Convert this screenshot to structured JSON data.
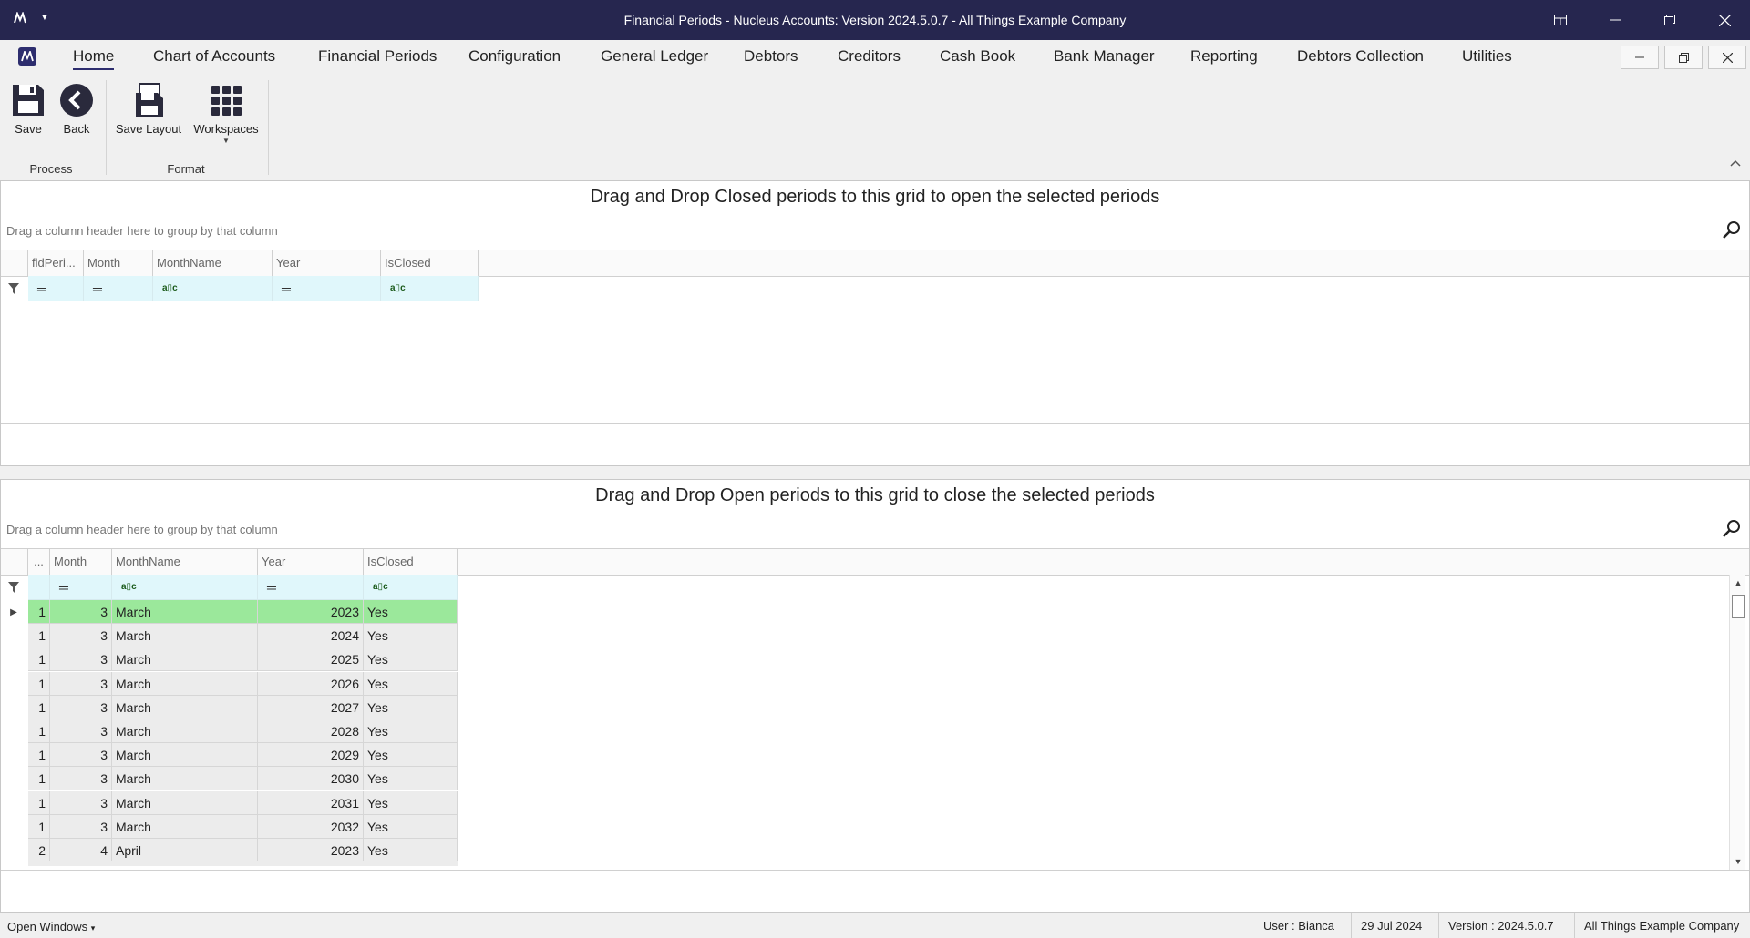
{
  "window": {
    "title": "Financial Periods - Nucleus Accounts: Version 2024.5.0.7 - All Things Example Company"
  },
  "menu": {
    "items": [
      "Home",
      "Chart of Accounts",
      "Financial Periods",
      "Configuration",
      "General Ledger",
      "Debtors",
      "Creditors",
      "Cash Book",
      "Bank Manager",
      "Reporting",
      "Debtors Collection",
      "Utilities"
    ],
    "active": "Home"
  },
  "ribbon": {
    "save": "Save",
    "back": "Back",
    "save_layout": "Save Layout",
    "workspaces": "Workspaces",
    "group_process": "Process",
    "group_format": "Format"
  },
  "closed_panel": {
    "title": "Drag and Drop Closed periods to this grid to open the selected periods",
    "group_hint": "Drag a column header here to group by that column",
    "columns": [
      "fldPeri...",
      "Month",
      "MonthName",
      "Year",
      "IsClosed"
    ]
  },
  "open_panel": {
    "title": "Drag and Drop Open periods to this grid to close the selected periods",
    "group_hint": "Drag a column header here to group by that column",
    "columns": [
      "...",
      "Month",
      "MonthName",
      "Year",
      "IsClosed"
    ],
    "rows": [
      {
        "id": "1",
        "month": "3",
        "month_name": "March",
        "year": "2023",
        "is_closed": "Yes"
      },
      {
        "id": "1",
        "month": "3",
        "month_name": "March",
        "year": "2024",
        "is_closed": "Yes"
      },
      {
        "id": "1",
        "month": "3",
        "month_name": "March",
        "year": "2025",
        "is_closed": "Yes"
      },
      {
        "id": "1",
        "month": "3",
        "month_name": "March",
        "year": "2026",
        "is_closed": "Yes"
      },
      {
        "id": "1",
        "month": "3",
        "month_name": "March",
        "year": "2027",
        "is_closed": "Yes"
      },
      {
        "id": "1",
        "month": "3",
        "month_name": "March",
        "year": "2028",
        "is_closed": "Yes"
      },
      {
        "id": "1",
        "month": "3",
        "month_name": "March",
        "year": "2029",
        "is_closed": "Yes"
      },
      {
        "id": "1",
        "month": "3",
        "month_name": "March",
        "year": "2030",
        "is_closed": "Yes"
      },
      {
        "id": "1",
        "month": "3",
        "month_name": "March",
        "year": "2031",
        "is_closed": "Yes"
      },
      {
        "id": "1",
        "month": "3",
        "month_name": "March",
        "year": "2032",
        "is_closed": "Yes"
      },
      {
        "id": "2",
        "month": "4",
        "month_name": "April",
        "year": "2023",
        "is_closed": "Yes"
      }
    ]
  },
  "statusbar": {
    "open_windows": "Open Windows",
    "user": "User : Bianca",
    "date": "29 Jul 2024",
    "version": "Version : 2024.5.0.7",
    "company": "All Things Example Company"
  },
  "colors": {
    "titlebar": "#26264f",
    "selected_row": "#9be89b",
    "filter_row": "#e0f7fb"
  }
}
